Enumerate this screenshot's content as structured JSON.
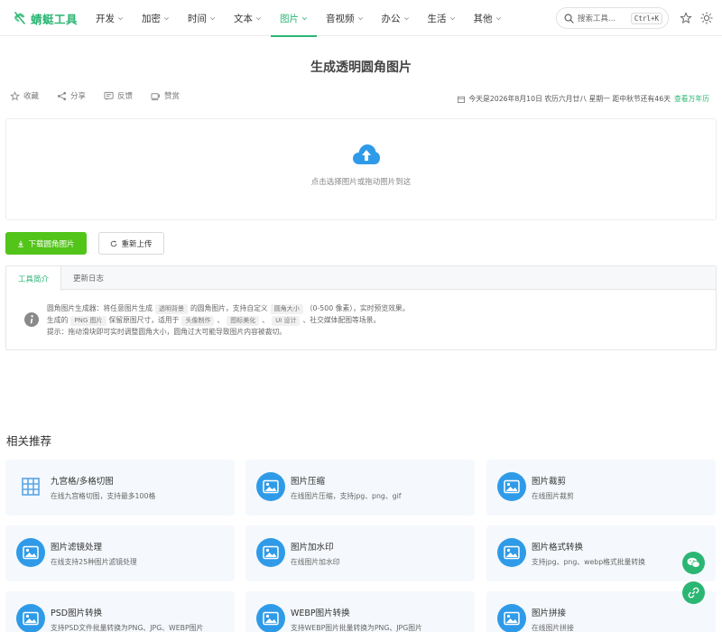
{
  "app": {
    "logo_text": "蜻蜓工具"
  },
  "nav": {
    "items": [
      {
        "label": "开发",
        "active": false
      },
      {
        "label": "加密",
        "active": false
      },
      {
        "label": "时间",
        "active": false
      },
      {
        "label": "文本",
        "active": false
      },
      {
        "label": "图片",
        "active": true
      },
      {
        "label": "音视频",
        "active": false
      },
      {
        "label": "办公",
        "active": false
      },
      {
        "label": "生活",
        "active": false
      },
      {
        "label": "其他",
        "active": false
      }
    ],
    "search_placeholder": "搜索工具...",
    "search_shortcut": "Ctrl+K"
  },
  "page": {
    "title": "生成透明圆角图片",
    "toolbar": {
      "favorite": "收藏",
      "share": "分享",
      "feedback": "反馈",
      "donate": "赞赏"
    },
    "date_text": "今天是2026年8月10日 农历六月廿八 星期一 距中秋节还有46天",
    "date_link": "查看万年历"
  },
  "upload": {
    "prompt": "点击选择图片或拖动图片到这"
  },
  "actions": {
    "download": "下载圆角图片",
    "reupload": "重新上传"
  },
  "tabs": [
    {
      "label": "工具简介",
      "active": true
    },
    {
      "label": "更新日志",
      "active": false
    }
  ],
  "intro": {
    "line1_a": "圆角图片生成器：将任意图片生成",
    "chip1": "透明背景",
    "line1_b": "的圆角图片，支持自定义",
    "chip2": "圆角大小",
    "line1_c": "（0-500 像素），实时预览效果。",
    "line2_a": "生成的",
    "chip3": "PNG 图片",
    "line2_b": "保留原图尺寸，适用于",
    "chip4": "头像制作",
    "sep1": "、",
    "chip5": "图标美化",
    "sep2": "、",
    "chip6": "UI 设计",
    "line2_c": "、社交媒体配图等场景。",
    "line3": "提示：拖动滑块即可实时调整圆角大小，圆角过大可能导致图片内容被裁切。"
  },
  "related": {
    "title": "相关推荐",
    "cards": [
      {
        "name": "九宫格/多格切图",
        "desc": "在线九宫格切图，支持最多100格",
        "icon": "grid-icon"
      },
      {
        "name": "图片压缩",
        "desc": "在线图片压缩，支持jpg、png、gif",
        "icon": "image-icon"
      },
      {
        "name": "图片裁剪",
        "desc": "在线图片裁剪",
        "icon": "image-icon"
      },
      {
        "name": "图片滤镜处理",
        "desc": "在线支持25种图片滤镜处理",
        "icon": "image-icon"
      },
      {
        "name": "图片加水印",
        "desc": "在线图片加水印",
        "icon": "image-icon"
      },
      {
        "name": "图片格式转换",
        "desc": "支持jpg、png、webp格式批量转换",
        "icon": "image-icon"
      },
      {
        "name": "PSD图片转换",
        "desc": "支持PSD文件批量转换为PNG、JPG、WEBP图片",
        "icon": "image-icon"
      },
      {
        "name": "WEBP图片转换",
        "desc": "支持WEBP图片批量转换为PNG、JPG图片",
        "icon": "image-icon"
      },
      {
        "name": "图片拼接",
        "desc": "在线图片拼接",
        "icon": "image-icon"
      }
    ]
  },
  "colors": {
    "accent": "#2bb673",
    "primary_button": "#52c41a",
    "icon_blue": "#2f9be8"
  }
}
